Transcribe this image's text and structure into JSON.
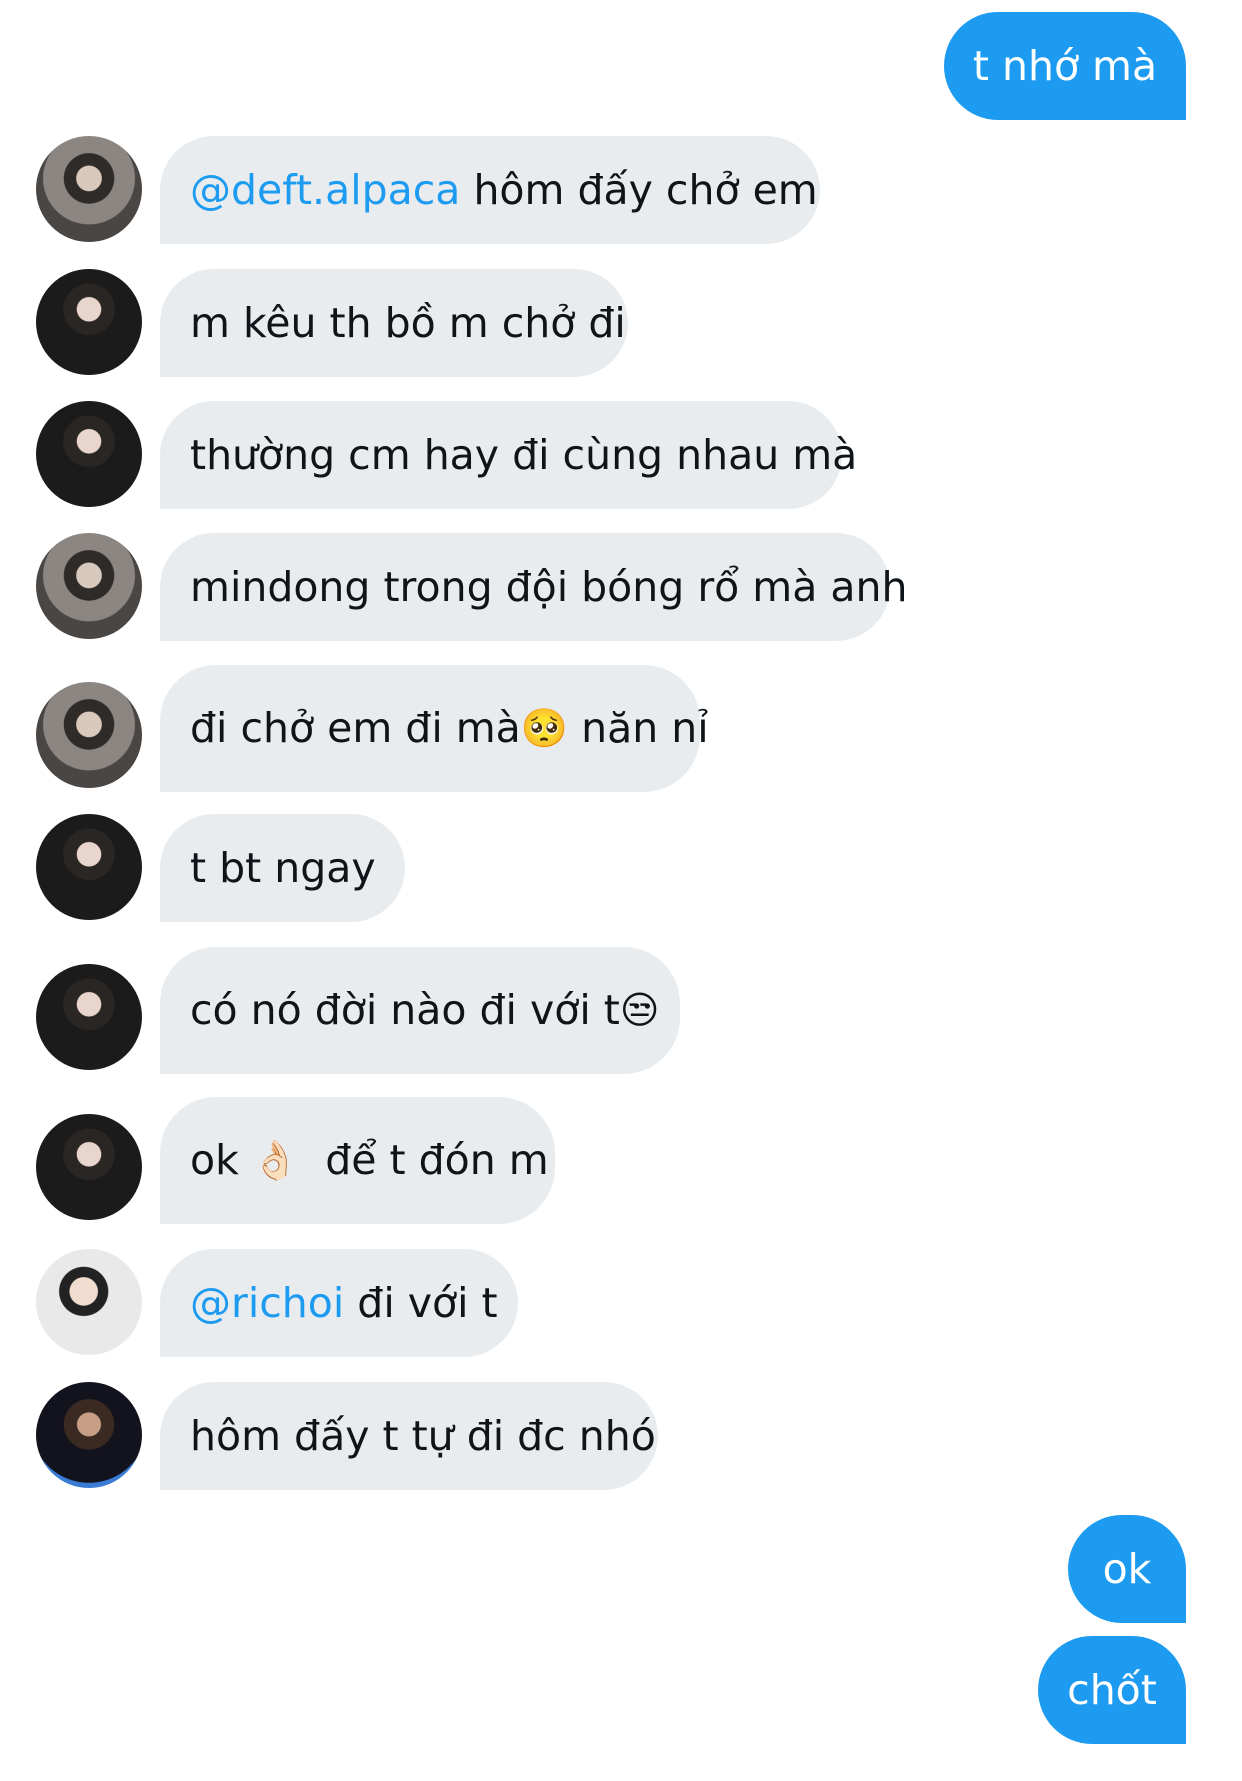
{
  "outgoing": [
    {
      "text": "t nhớ mà"
    },
    {
      "text": "ok"
    },
    {
      "text": "chốt"
    }
  ],
  "incoming": [
    {
      "avatar": "avatar-1",
      "mention": "@deft.alpaca",
      "text": " hôm đấy chở em"
    },
    {
      "avatar": "avatar-2",
      "text": "m kêu th bồ m chở đi"
    },
    {
      "avatar": "avatar-2",
      "text": "thường cm hay đi cùng nhau mà"
    },
    {
      "avatar": "avatar-1",
      "text": "mindong trong đội bóng rổ mà anh"
    },
    {
      "avatar": "avatar-1",
      "text": "đi chở em đi mà",
      "emoji": "🥺",
      "text2": " năn nỉ"
    },
    {
      "avatar": "avatar-2",
      "text": "t bt ngay"
    },
    {
      "avatar": "avatar-2",
      "text": "có nó đời nào đi với t",
      "emoji": "😒"
    },
    {
      "avatar": "avatar-2",
      "text": "ok ",
      "emoji": "👌🏻",
      "text2": "  để t đón m"
    },
    {
      "avatar": "avatar-3",
      "mention": "@richoi",
      "text": " đi với t"
    },
    {
      "avatar": "avatar-4",
      "text": "hôm đấy t tự đi đc nhó"
    }
  ]
}
